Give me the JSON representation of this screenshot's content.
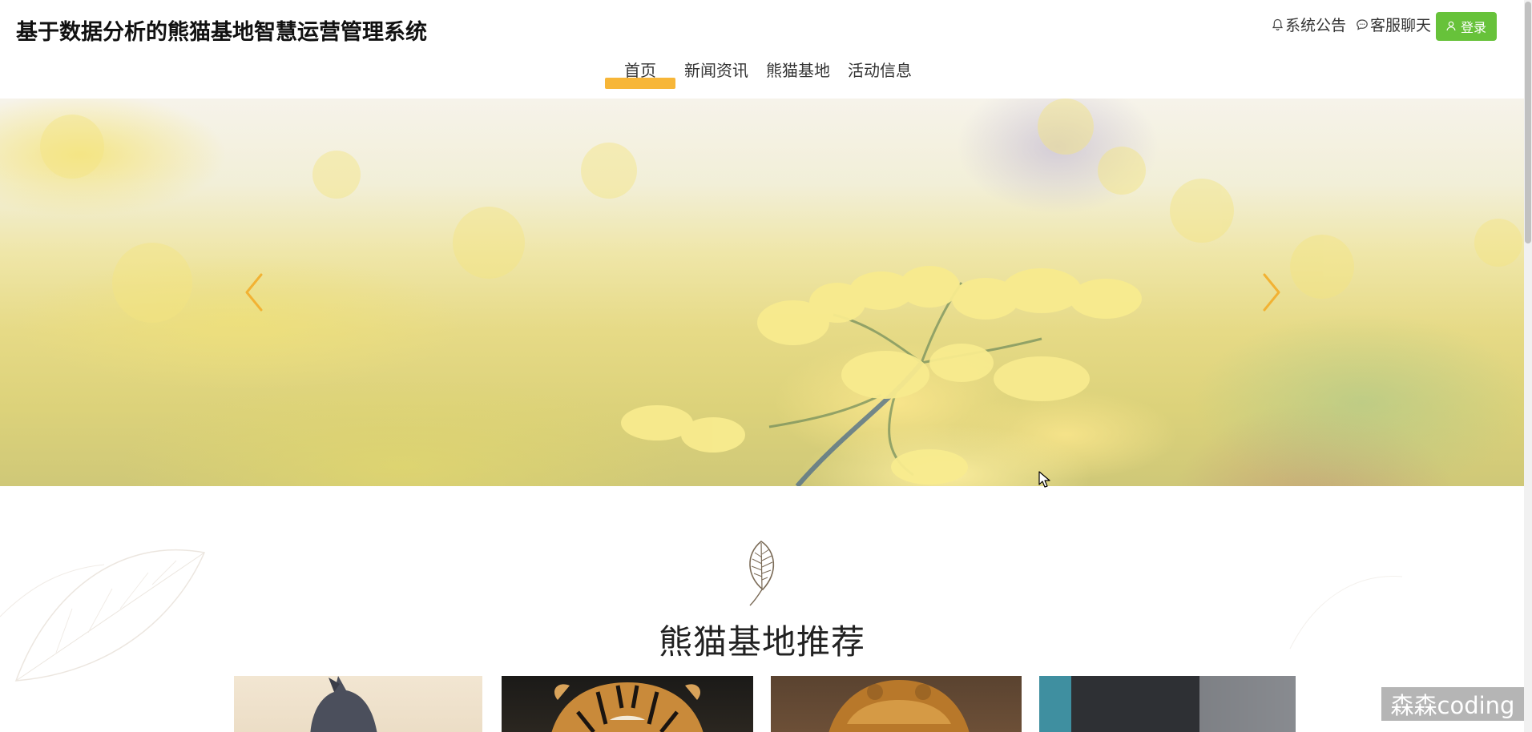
{
  "header": {
    "site_title": "基于数据分析的熊猫基地智慧运营管理系统",
    "announcements_label": "系统公告",
    "chat_label": "客服聊天",
    "login_label": "登录"
  },
  "nav": {
    "items": [
      {
        "label": "首页",
        "active": true
      },
      {
        "label": "新闻资讯",
        "active": false
      },
      {
        "label": "熊猫基地",
        "active": false
      },
      {
        "label": "活动信息",
        "active": false
      }
    ]
  },
  "banner": {
    "prev_icon": "chevron-left-icon",
    "next_icon": "chevron-right-icon"
  },
  "section": {
    "title": "熊猫基地推荐",
    "icon": "leaf-icon"
  },
  "cards": [
    {
      "subject": "squirrel"
    },
    {
      "subject": "tiger"
    },
    {
      "subject": "monkey"
    },
    {
      "subject": "animal"
    }
  ],
  "watermark": {
    "text": "森森coding"
  },
  "colors": {
    "accent": "#f7b638",
    "login_button": "#67c23a",
    "arrow": "#f2b233"
  }
}
